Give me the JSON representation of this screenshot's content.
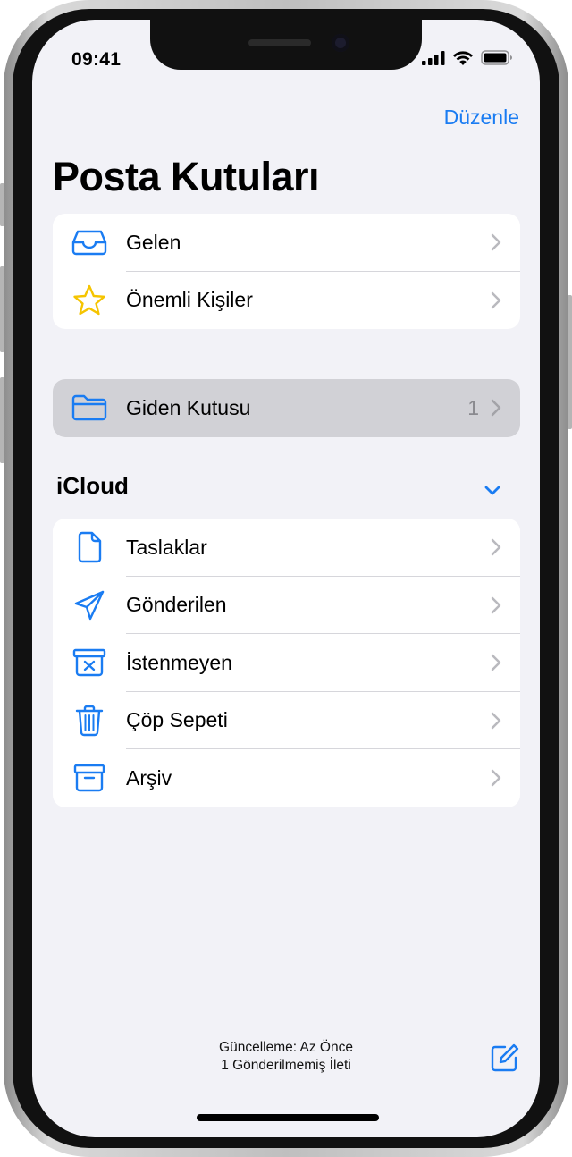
{
  "status_bar": {
    "time": "09:41"
  },
  "nav": {
    "edit_label": "Düzenle"
  },
  "page": {
    "title": "Posta Kutuları"
  },
  "primary_mailboxes": [
    {
      "label": "Gelen",
      "icon": "inbox-icon"
    },
    {
      "label": "Önemli Kişiler",
      "icon": "star-icon"
    }
  ],
  "outbox": {
    "label": "Giden Kutusu",
    "count": "1",
    "icon": "folder-icon"
  },
  "account": {
    "name": "iCloud",
    "folders": [
      {
        "label": "Taslaklar",
        "icon": "draft-document-icon"
      },
      {
        "label": "Gönderilen",
        "icon": "paper-plane-icon"
      },
      {
        "label": "İstenmeyen",
        "icon": "junk-bin-icon"
      },
      {
        "label": "Çöp Sepeti",
        "icon": "trash-icon"
      },
      {
        "label": "Arşiv",
        "icon": "archive-box-icon"
      }
    ]
  },
  "footer": {
    "updated": "Güncelleme: Az Önce",
    "unsent": "1 Gönderilmemiş İleti"
  },
  "colors": {
    "accent": "#1a7cf2",
    "star": "#f5c400",
    "background": "#f2f2f7",
    "highlight_row": "#d1d1d6"
  }
}
